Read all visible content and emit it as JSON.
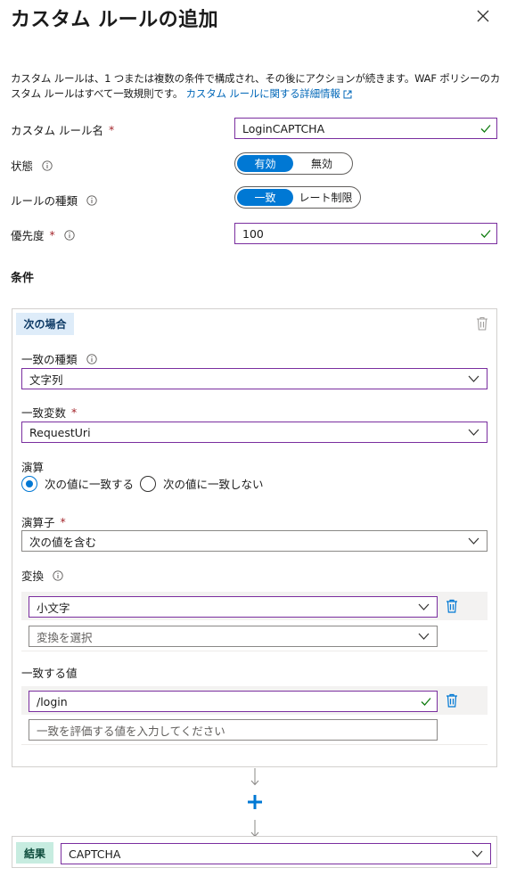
{
  "panel": {
    "title": "カスタム ルールの追加",
    "description": "カスタム ルールは、1 つまたは複数の条件で構成され、その後にアクションが続きます。WAF ポリシーのカスタム ルールはすべて一致規則です。",
    "learn_more": "カスタム ルールに関する詳細情報"
  },
  "fields": {
    "rule_name_label": "カスタム ルール名",
    "rule_name_value": "LoginCAPTCHA",
    "status_label": "状態",
    "status_on": "有効",
    "status_off": "無効",
    "rule_type_label": "ルールの種類",
    "rule_type_on": "一致",
    "rule_type_off": "レート制限",
    "priority_label": "優先度",
    "priority_value": "100",
    "required_mark": "*"
  },
  "conditions": {
    "section_title": "条件",
    "if_tag": "次の場合",
    "match_type_label": "一致の種類",
    "match_type_value": "文字列",
    "match_variable_label": "一致変数",
    "match_variable_value": "RequestUri",
    "operation_label": "演算",
    "operation_is": "次の値に一致する",
    "operation_is_not": "次の値に一致しない",
    "operator_label": "演算子",
    "operator_value": "次の値を含む",
    "transform_label": "変換",
    "transform_value": "小文字",
    "transform_placeholder": "変換を選択",
    "match_values_label": "一致する値",
    "match_value": "/login",
    "match_value_placeholder": "一致を評価する値を入力してください"
  },
  "result": {
    "tag": "結果",
    "value": "CAPTCHA"
  },
  "colors": {
    "accent": "#0078d4",
    "link": "#0067b8",
    "focus_border": "#7a2e9f",
    "success": "#107c10",
    "required": "#a4262c"
  }
}
